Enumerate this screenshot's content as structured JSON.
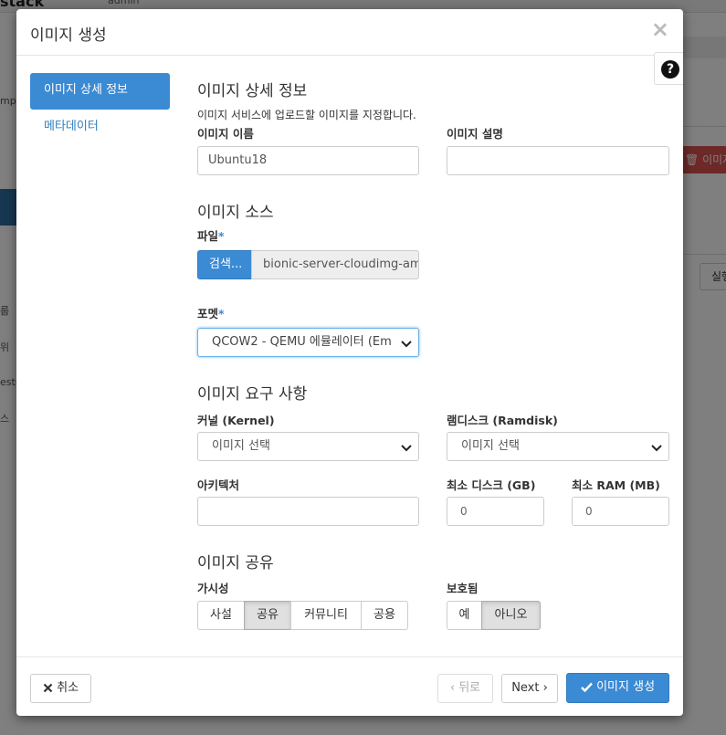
{
  "background": {
    "brand": "stack",
    "user": "admin",
    "side_texts": [
      "mpu",
      "룹",
      "위",
      "estr",
      "스"
    ],
    "delete_label": "이미지",
    "run_label": "실행"
  },
  "modal": {
    "title": "이미지 생성",
    "close_symbol": "×",
    "help_symbol": "?",
    "nav": [
      {
        "label": "이미지 상세 정보"
      },
      {
        "label": "메타데이터"
      }
    ],
    "details": {
      "title": "이미지 상세 정보",
      "help": "이미지 서비스에 업로드할 이미지를 지정합니다.",
      "name_label": "이미지 이름",
      "name_value": "Ubuntu18",
      "desc_label": "이미지 설명",
      "desc_value": ""
    },
    "source": {
      "title": "이미지 소스",
      "file_label": "파일",
      "browse_label": "검색...",
      "file_name": "bionic-server-cloudimg-am",
      "format_label": "포멧",
      "format_value": "QCOW2 - QEMU 에뮬레이터 (Em",
      "required_mark": "*"
    },
    "requirements": {
      "title": "이미지 요구 사항",
      "kernel_label": "커널 (Kernel)",
      "kernel_value": "이미지 선택",
      "ramdisk_label": "램디스크 (Ramdisk)",
      "ramdisk_value": "이미지 선택",
      "arch_label": "아키텍처",
      "arch_value": "",
      "min_disk_label": "최소 디스크 (GB)",
      "min_disk_value": "0",
      "min_ram_label": "최소 RAM (MB)",
      "min_ram_value": "0"
    },
    "sharing": {
      "title": "이미지 공유",
      "visibility_label": "가시성",
      "visibility_options": [
        "사설",
        "공유",
        "커뮤니티",
        "공용"
      ],
      "visibility_selected": "공유",
      "protected_label": "보호됨",
      "protected_options": [
        "예",
        "아니오"
      ],
      "protected_selected": "아니오"
    },
    "footer": {
      "cancel_label": "취소",
      "back_label": "‹ 뒤로",
      "next_label": "Next ›",
      "create_label": "이미지 생성"
    }
  },
  "colors": {
    "accent": "#3b8ad4",
    "danger": "#d9534f"
  }
}
